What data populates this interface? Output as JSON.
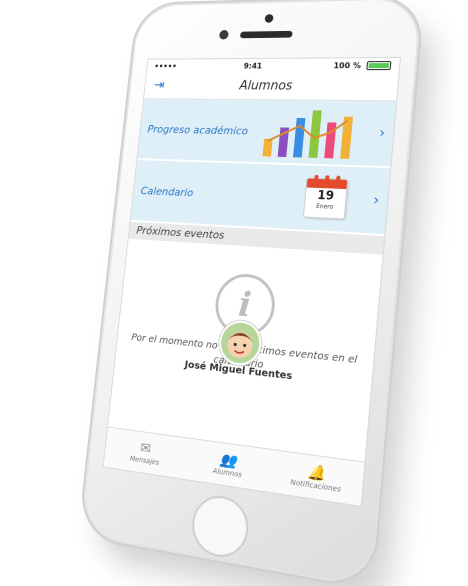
{
  "status": {
    "carrier": "•••••",
    "time": "9:41",
    "battery": "100 %"
  },
  "header": {
    "title": "Alumnos"
  },
  "rows": {
    "progress": {
      "label": "Progreso académico"
    },
    "calendar": {
      "label": "Calendario",
      "day": "19",
      "month": "Enero"
    }
  },
  "section": {
    "title": "Próximos eventos"
  },
  "empty": {
    "message": "Por el momento no hay próximos eventos en el calendario"
  },
  "student": {
    "name": "José Miguel Fuentes"
  },
  "tabs": [
    {
      "label": "Mensajes",
      "icon": "mail-icon"
    },
    {
      "label": "Alumnos",
      "icon": "students-icon"
    },
    {
      "label": "Notificaciones",
      "icon": "bell-icon"
    }
  ],
  "colors": {
    "accent": "#2a76c6",
    "row_bg": "#dfeff8",
    "section_bg": "#e9e9e9",
    "calendar_red": "#e44a2e"
  }
}
